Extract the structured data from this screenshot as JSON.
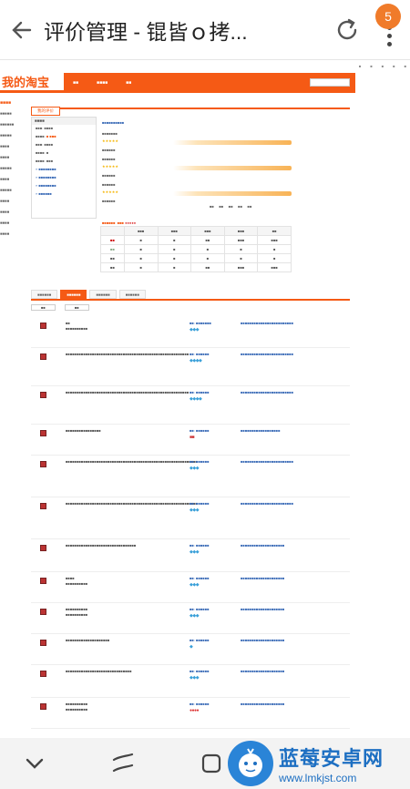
{
  "browser": {
    "title": "评价管理 - 锟皆ｏ拷...",
    "tab_count": "5"
  },
  "site": {
    "logo": "我的淘宝",
    "tab_label": "我的评价"
  },
  "watermark": {
    "name": "蓝莓安卓网",
    "url": "www.lmkjst.com"
  },
  "colors": {
    "accent": "#f55a15",
    "badge": "#f07b2a",
    "watermark": "#1d6fc2"
  }
}
